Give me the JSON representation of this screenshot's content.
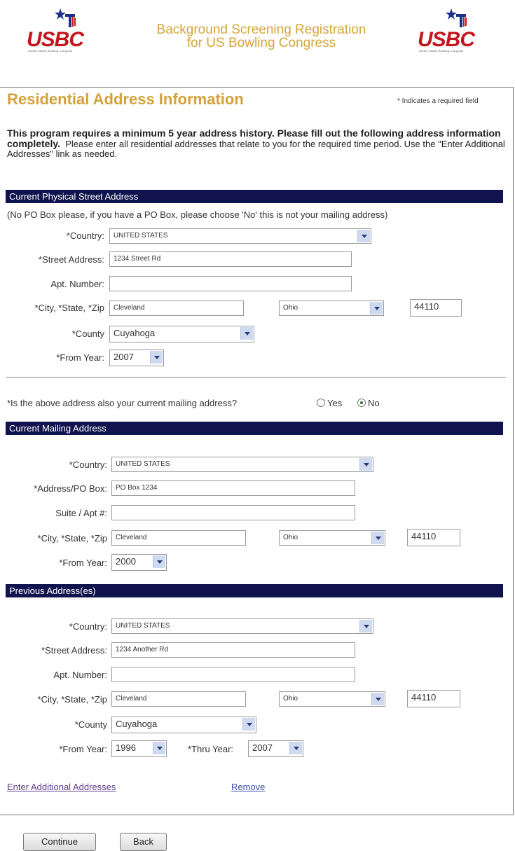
{
  "header": {
    "title_line1": "Background Screening Registration",
    "title_line2": "for US Bowling Congress",
    "logo_text": "USBC",
    "logo_tagline": "United States Bowling Congress"
  },
  "page": {
    "title": "Residential Address Information",
    "required_note": "* Indicates a required field",
    "intro_bold": "This program requires a minimum 5 year address history.  Please fill out the following address information completely.",
    "intro_text": "Please enter all residential addresses that relate to you for the required time period.  Use the \"Enter Additional Addresses\" link as needed."
  },
  "physical": {
    "heading": "Current Physical Street Address",
    "note": "(No PO Box please, if you have a PO Box, please choose 'No' this is not your mailing address)",
    "country_label": "*Country:",
    "country_value": "UNITED STATES",
    "street_label": "*Street Address:",
    "street_value": "1234 Street Rd",
    "apt_label": "Apt. Number:",
    "apt_value": "",
    "csz_label": "*City, *State, *Zip",
    "city_value": "Cleveland",
    "state_value": "Ohio",
    "zip_value": "44110",
    "county_label": "*County",
    "county_value": "Cuyahoga",
    "from_label": "*From Year:",
    "from_value": "2007"
  },
  "mailing_question": {
    "text": "*Is the above address also your current mailing address?",
    "yes_label": "Yes",
    "no_label": "No",
    "selected": "No"
  },
  "mailing": {
    "heading": "Current Mailing Address",
    "country_label": "*Country:",
    "country_value": "UNITED STATES",
    "address_label": "*Address/PO Box:",
    "address_value": "PO Box 1234",
    "suite_label": "Suite / Apt #:",
    "suite_value": "",
    "csz_label": "*City, *State, *Zip",
    "city_value": "Cleveland",
    "state_value": "Ohio",
    "zip_value": "44110",
    "from_label": "*From Year:",
    "from_value": "2000"
  },
  "previous": {
    "heading": "Previous Address(es)",
    "country_label": "*Country:",
    "country_value": "UNITED STATES",
    "street_label": "*Street Address:",
    "street_value": "1234 Another Rd",
    "apt_label": "Apt. Number:",
    "apt_value": "",
    "csz_label": "*City, *State, *Zip",
    "city_value": "Cleveland",
    "state_value": "Ohio",
    "zip_value": "44110",
    "county_label": "*County",
    "county_value": "Cuyahoga",
    "from_label": "*From Year:",
    "from_value": "1996",
    "thru_label": "*Thru Year:",
    "thru_value": "2007"
  },
  "links": {
    "add_more": "Enter Additional Addresses",
    "remove": "Remove"
  },
  "buttons": {
    "continue": "Continue",
    "back": "Back"
  }
}
